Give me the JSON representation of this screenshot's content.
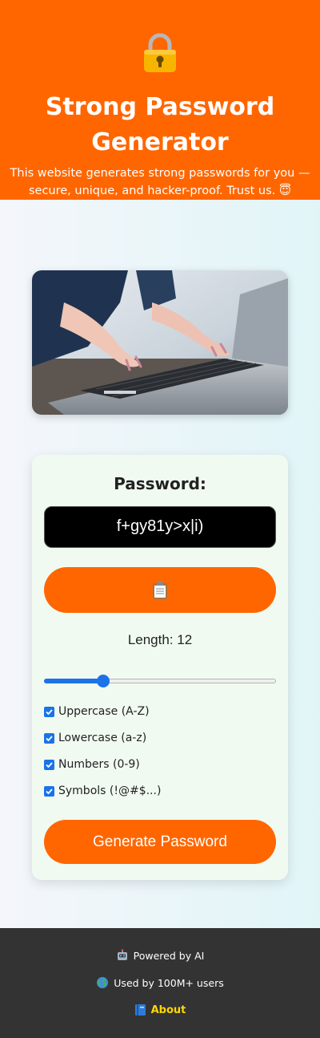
{
  "header": {
    "icon": "lock-icon",
    "title": "Strong Password Generator",
    "subtitle": "This website generates strong passwords for you — secure, unique, and hacker-proof. Trust us. 😇",
    "background": "#ff6600"
  },
  "hero_image": {
    "icon": "laptop-typing-photo"
  },
  "generator": {
    "password_label": "Password:",
    "password_value": "f+gy81y>x|i)",
    "copy_icon": "clipboard-icon",
    "length_label": "Length: 12",
    "length_value": 12,
    "length_slider_fraction": 0.24,
    "options": [
      {
        "label": "Uppercase (A-Z)",
        "checked": true
      },
      {
        "label": "Lowercase (a-z)",
        "checked": true
      },
      {
        "label": "Numbers (0-9)",
        "checked": true
      },
      {
        "label": "Symbols (!@#$...)",
        "checked": true
      }
    ],
    "generate_label": "Generate Password",
    "accent": "#ff6600",
    "slider_color": "#1a73e8"
  },
  "footer": {
    "powered_icon": "robot-icon",
    "powered": "Powered by AI",
    "users_icon": "globe-icon",
    "users": "Used by 100M+ users",
    "about_icon": "book-icon",
    "about": "About",
    "about_color": "#ffd700"
  }
}
